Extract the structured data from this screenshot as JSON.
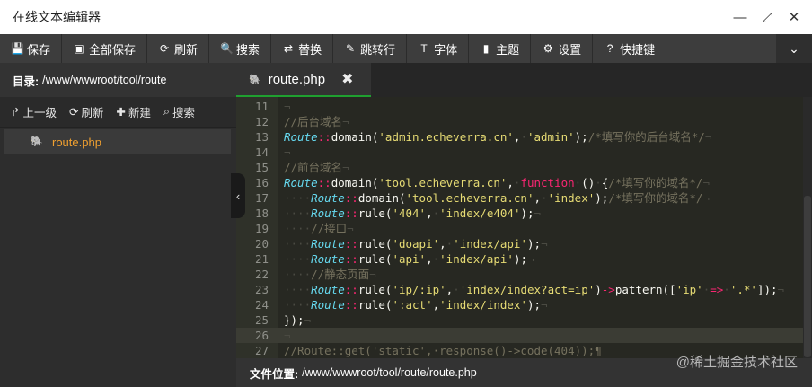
{
  "window": {
    "title": "在线文本编辑器",
    "controls": [
      "—",
      "⤢",
      "✕"
    ]
  },
  "toolbar": {
    "buttons": [
      {
        "icon": "💾",
        "label": "保存"
      },
      {
        "icon": "▣",
        "label": "全部保存"
      },
      {
        "icon": "⟳",
        "label": "刷新"
      },
      {
        "icon": "🔍",
        "label": "搜索"
      },
      {
        "icon": "⇄",
        "label": "替换"
      },
      {
        "icon": "✎",
        "label": "跳转行"
      },
      {
        "icon": "T",
        "label": "字体"
      },
      {
        "icon": "▮",
        "label": "主题"
      },
      {
        "icon": "⚙",
        "label": "设置"
      },
      {
        "icon": "?",
        "label": "快捷键"
      }
    ],
    "more_icon": "⌄"
  },
  "sidebar": {
    "dir_label": "目录:",
    "dir_path": "/www/wwwroot/tool/route",
    "actions": [
      {
        "icon": "↱",
        "label": "上一级"
      },
      {
        "icon": "⟳",
        "label": "刷新"
      },
      {
        "icon": "✚",
        "label": "新建"
      },
      {
        "icon": "⌕",
        "label": "搜索"
      }
    ],
    "files": [
      {
        "icon": "🐘",
        "name": "route.php"
      }
    ],
    "collapse_icon": "‹"
  },
  "tabs": [
    {
      "icon": "🐘",
      "label": "route.php",
      "close": "✖"
    }
  ],
  "editor": {
    "active_line": 26,
    "lines": [
      {
        "n": "11",
        "html": "<span class='ws'>¬</span>"
      },
      {
        "n": "12",
        "html": "<span class='c'>//后台域名</span><span class='ws'>¬</span>"
      },
      {
        "n": "13",
        "html": "<span class='k'>Route</span><span class='op'>::</span>domain(<span class='s'>'admin.echeverra.cn'</span>,<span class='ws'>·</span><span class='s'>'admin'</span>);<span class='c'>/*填写你的后台域名*/</span><span class='ws'>¬</span>"
      },
      {
        "n": "14",
        "html": "<span class='ws'>¬</span>"
      },
      {
        "n": "15",
        "html": "<span class='c'>//前台域名</span><span class='ws'>¬</span>"
      },
      {
        "n": "16",
        "html": "<span class='k'>Route</span><span class='op'>::</span>domain(<span class='s'>'tool.echeverra.cn'</span>,<span class='ws'>·</span><span class='kw'>function</span><span class='ws'>·</span>()<span class='ws'>·</span>{<span class='c'>/*填写你的域名*/</span><span class='ws'>¬</span>"
      },
      {
        "n": "17",
        "html": "<span class='ws'>····</span><span class='k'>Route</span><span class='op'>::</span>domain(<span class='s'>'tool.echeverra.cn'</span>,<span class='ws'>·</span><span class='s'>'index'</span>);<span class='c'>/*填写你的域名*/</span><span class='ws'>¬</span>"
      },
      {
        "n": "18",
        "html": "<span class='ws'>····</span><span class='k'>Route</span><span class='op'>::</span>rule(<span class='s'>'404'</span>,<span class='ws'>·</span><span class='s'>'index/e404'</span>);<span class='ws'>¬</span>"
      },
      {
        "n": "19",
        "html": "<span class='ws'>····</span><span class='c'>//接口</span><span class='ws'>¬</span>"
      },
      {
        "n": "20",
        "html": "<span class='ws'>····</span><span class='k'>Route</span><span class='op'>::</span>rule(<span class='s'>'doapi'</span>,<span class='ws'>·</span><span class='s'>'index/api'</span>);<span class='ws'>¬</span>"
      },
      {
        "n": "21",
        "html": "<span class='ws'>····</span><span class='k'>Route</span><span class='op'>::</span>rule(<span class='s'>'api'</span>,<span class='ws'>·</span><span class='s'>'index/api'</span>);<span class='ws'>¬</span>"
      },
      {
        "n": "22",
        "html": "<span class='ws'>····</span><span class='c'>//静态页面</span><span class='ws'>¬</span>"
      },
      {
        "n": "23",
        "html": "<span class='ws'>····</span><span class='k'>Route</span><span class='op'>::</span>rule(<span class='s'>'ip/:ip'</span>,<span class='ws'>·</span><span class='s'>'index/index?act=ip'</span>)<span class='op'>-></span>pattern([<span class='s'>'ip'</span><span class='ws'>·</span><span class='op'>=></span><span class='ws'>·</span><span class='s'>'.*'</span>]);<span class='ws'>¬</span>"
      },
      {
        "n": "24",
        "html": "<span class='ws'>····</span><span class='k'>Route</span><span class='op'>::</span>rule(<span class='s'>':act'</span>,<span class='s'>'index/index'</span>);<span class='ws'>¬</span>"
      },
      {
        "n": "25",
        "html": "});<span class='ws'>¬</span>"
      },
      {
        "n": "26",
        "html": "<span class='ws'>¬</span>"
      },
      {
        "n": "27",
        "html": "<span class='c'>//Route::get('static',·response()->code(404));¶</span>"
      }
    ]
  },
  "status": {
    "label": "文件位置:",
    "path": "/www/wwwroot/tool/route/route.php"
  },
  "watermark": "@稀土掘金技术社区"
}
